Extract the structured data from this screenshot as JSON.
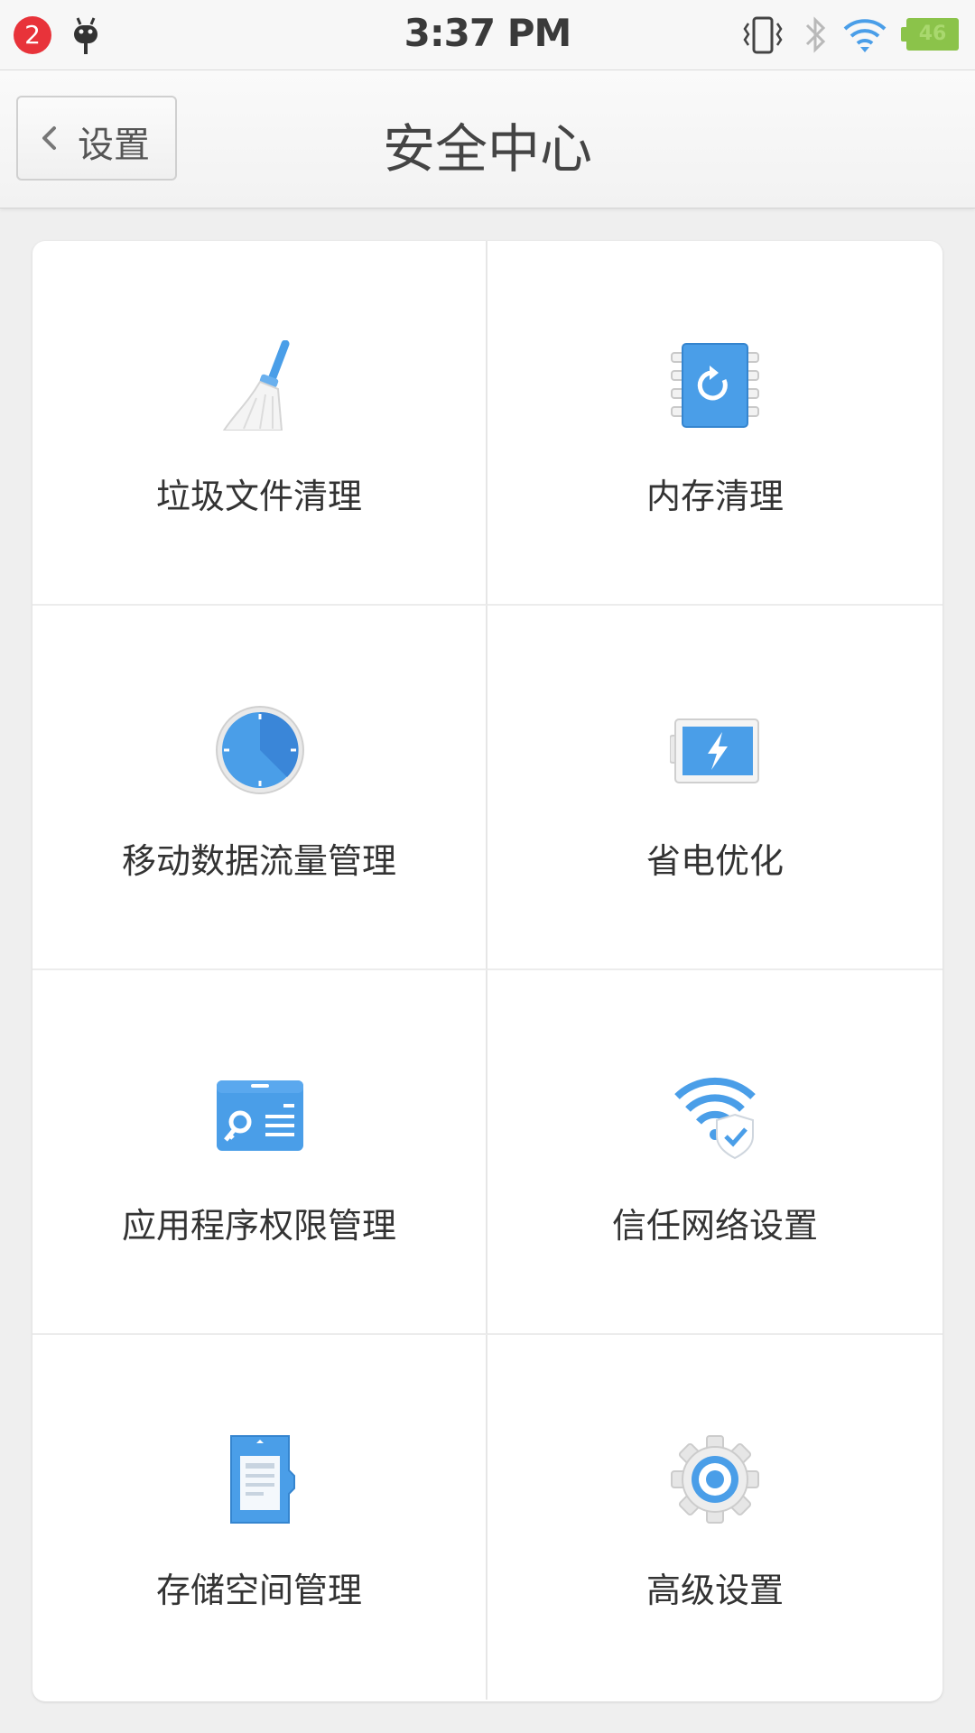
{
  "status_bar": {
    "notification_count": "2",
    "time": "3:37 PM",
    "battery": "46",
    "icons": [
      "android-icon",
      "vibrate-icon",
      "bluetooth-icon",
      "wifi-icon",
      "battery-icon"
    ]
  },
  "header": {
    "back_label": "设置",
    "title": "安全中心"
  },
  "tiles": [
    {
      "label": "垃圾文件清理",
      "icon": "broom-icon"
    },
    {
      "label": "内存清理",
      "icon": "memory-chip-icon"
    },
    {
      "label": "移动数据流量管理",
      "icon": "clock-gauge-icon"
    },
    {
      "label": "省电优化",
      "icon": "battery-charge-icon"
    },
    {
      "label": "应用程序权限管理",
      "icon": "key-card-icon"
    },
    {
      "label": "信任网络设置",
      "icon": "shield-wifi-icon"
    },
    {
      "label": "存储空间管理",
      "icon": "sd-card-icon"
    },
    {
      "label": "高级设置",
      "icon": "gear-icon"
    }
  ],
  "colors": {
    "accent_blue": "#4a9ee8",
    "notif_red": "#e8333a",
    "battery_green": "#8bc34a"
  }
}
